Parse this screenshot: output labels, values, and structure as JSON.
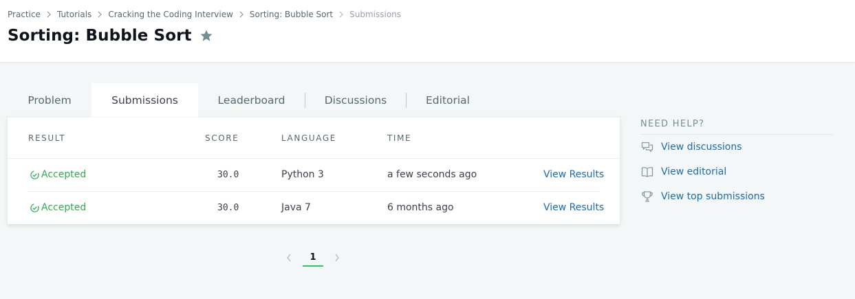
{
  "breadcrumb": {
    "items": [
      "Practice",
      "Tutorials",
      "Cracking the Coding Interview",
      "Sorting: Bubble Sort"
    ],
    "current": "Submissions"
  },
  "page": {
    "title": "Sorting: Bubble Sort",
    "star_icon": "star-icon"
  },
  "tabs": [
    "Problem",
    "Submissions",
    "Leaderboard",
    "Discussions",
    "Editorial"
  ],
  "active_tab": "Submissions",
  "table": {
    "headers": {
      "result": "RESULT",
      "score": "SCORE",
      "language": "LANGUAGE",
      "time": "TIME"
    },
    "rows": [
      {
        "result": "Accepted",
        "score": "30.0",
        "language": "Python 3",
        "time": "a few seconds ago",
        "action": "View Results"
      },
      {
        "result": "Accepted",
        "score": "30.0",
        "language": "Java 7",
        "time": "6 months ago",
        "action": "View Results"
      }
    ]
  },
  "pagination": {
    "current_page": "1"
  },
  "help": {
    "title": "NEED HELP?",
    "items": [
      {
        "label": "View discussions",
        "icon": "discussions-icon"
      },
      {
        "label": "View editorial",
        "icon": "book-icon"
      },
      {
        "label": "View top submissions",
        "icon": "trophy-icon"
      }
    ]
  },
  "colors": {
    "accepted": "#32a852",
    "link": "#1a6cb0",
    "accent": "#2ec866",
    "title": "#0e141e"
  }
}
